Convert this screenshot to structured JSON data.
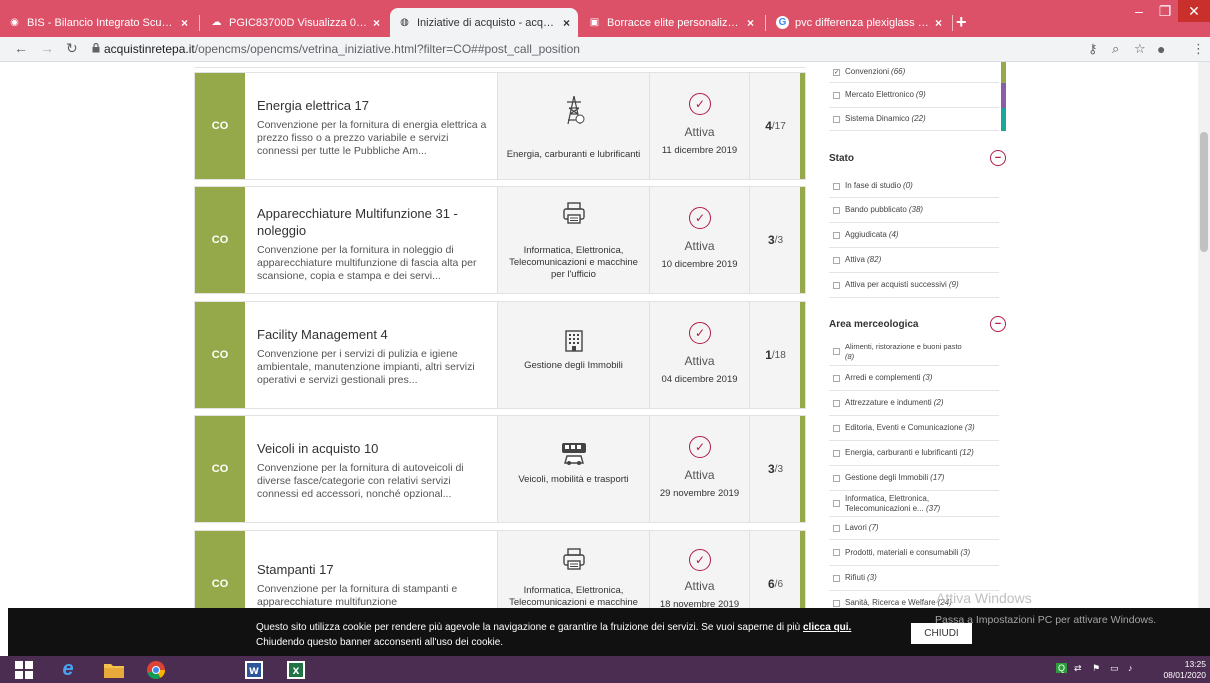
{
  "browser": {
    "tabs": [
      {
        "title": "BIS - Bilancio Integrato Scuole |",
        "fav": "globe-icon",
        "close": "×"
      },
      {
        "title": "PGIC83700D Visualizza 08/01/20",
        "fav": "cloud-icon",
        "close": "×"
      },
      {
        "title": "Iniziative di acquisto - acquistinre",
        "fav": "globe-icon",
        "close": "×"
      },
      {
        "title": "Borracce elite personalizzate - Bi",
        "fav": "shop-icon",
        "close": "×"
      },
      {
        "title": "pvc differenza plexiglass - Cerca",
        "fav": "google-icon",
        "close": "×"
      }
    ],
    "new_tab": "+",
    "url_host": "acquistinretepa.it",
    "url_path": "/opencms/opencms/vetrina_iniziative.html?filter=CO##post_call_position"
  },
  "cards": [
    {
      "badge": "CO",
      "title": "Energia elettrica 17",
      "desc": "Convenzione per la fornitura di energia elettrica a prezzo fisso o a prezzo variabile e servizi connessi per tutte le Pubbliche Am...",
      "icon": "power-tower-icon",
      "category": "Energia, carburanti e lubrificanti",
      "status": "Attiva",
      "date": "11 dicembre 2019",
      "lot": "4",
      "lot_total": "/17"
    },
    {
      "badge": "CO",
      "title": "Apparecchiature Multifunzione 31 - noleggio",
      "desc": "Convenzione per la fornitura in noleggio di apparecchiature multifunzione di fascia alta per scansione, copia e stampa e dei servi...",
      "icon": "printer-icon",
      "category": "Informatica, Elettronica, Telecomunicazioni e macchine per l'ufficio",
      "status": "Attiva",
      "date": "10 dicembre 2019",
      "lot": "3",
      "lot_total": "/3"
    },
    {
      "badge": "CO",
      "title": "Facility Management 4",
      "desc": "Convenzione per i servizi di pulizia e igiene ambientale, manutenzione impianti, altri servizi operativi e servizi gestionali pres...",
      "icon": "building-icon",
      "category": "Gestione degli Immobili",
      "status": "Attiva",
      "date": "04 dicembre 2019",
      "lot": "1",
      "lot_total": "/18"
    },
    {
      "badge": "CO",
      "title": "Veicoli in acquisto 10",
      "desc": "Convenzione per la fornitura di autoveicoli di diverse fasce/categorie con relativi servizi connessi ed accessori, nonché opzional...",
      "icon": "vehicles-icon",
      "category": "Veicoli, mobilità e trasporti",
      "status": "Attiva",
      "date": "29 novembre 2019",
      "lot": "3",
      "lot_total": "/3"
    },
    {
      "badge": "CO",
      "title": "Stampanti 17",
      "desc": "Convenzione per la fornitura di stampanti e apparecchiature multifunzione",
      "icon": "printer-icon",
      "category": "Informatica, Elettronica, Telecomunicazioni e macchine",
      "status": "Attiva",
      "date": "18 novembre 2019",
      "lot": "6",
      "lot_total": "/6"
    }
  ],
  "filters": {
    "strumento": [
      {
        "label": "Convenzioni",
        "count": "(66)",
        "checked": true
      },
      {
        "label": "Mercato Elettronico",
        "count": "(9)",
        "checked": false
      },
      {
        "label": "Sistema Dinamico",
        "count": "(22)",
        "checked": false
      }
    ],
    "stato_title": "Stato",
    "stato": [
      {
        "label": "In fase di studio",
        "count": "(0)"
      },
      {
        "label": "Bando pubblicato",
        "count": "(38)"
      },
      {
        "label": "Aggiudicata",
        "count": "(4)"
      },
      {
        "label": "Attiva",
        "count": "(82)"
      },
      {
        "label": "Attiva per acquisti successivi",
        "count": "(9)"
      }
    ],
    "area_title": "Area merceologica",
    "area": [
      {
        "label": "Alimenti, ristorazione e buoni pasto",
        "count": "(8)"
      },
      {
        "label": "Arredi e complementi",
        "count": "(3)"
      },
      {
        "label": "Attrezzature e indumenti",
        "count": "(2)"
      },
      {
        "label": "Editoria, Eventi e Comunicazione",
        "count": "(3)"
      },
      {
        "label": "Energia, carburanti e lubrificanti",
        "count": "(12)"
      },
      {
        "label": "Gestione degli Immobili",
        "count": "(17)"
      },
      {
        "label": "Informatica, Elettronica, Telecomunicazioni e...",
        "count": "(37)"
      },
      {
        "label": "Lavori",
        "count": "(7)"
      },
      {
        "label": "Prodotti, materiali e consumabili",
        "count": "(3)"
      },
      {
        "label": "Rifiuti",
        "count": "(3)"
      },
      {
        "label": "Sanità, Ricerca e Welfare",
        "count": "(24)"
      }
    ]
  },
  "cookie": {
    "text": "Questo sito utilizza cookie per rendere più agevole la navigazione e garantire la fruizione dei servizi. Se vuoi saperne di più ",
    "link": "clicca qui.",
    "text2": "Chiudendo questo banner acconsenti all'uso dei cookie.",
    "button": "CHIUDI"
  },
  "watermark": {
    "line1": "Attiva Windows",
    "line2": "Passa a Impostazioni PC per attivare Windows."
  },
  "taskbar": {
    "time": "13:25",
    "date": "08/01/2020"
  },
  "colors": {
    "accent_green": "#95a84a",
    "accent_red": "#b11c45",
    "tab_bar": "#dc5068",
    "taskbar": "#4b2d52"
  }
}
